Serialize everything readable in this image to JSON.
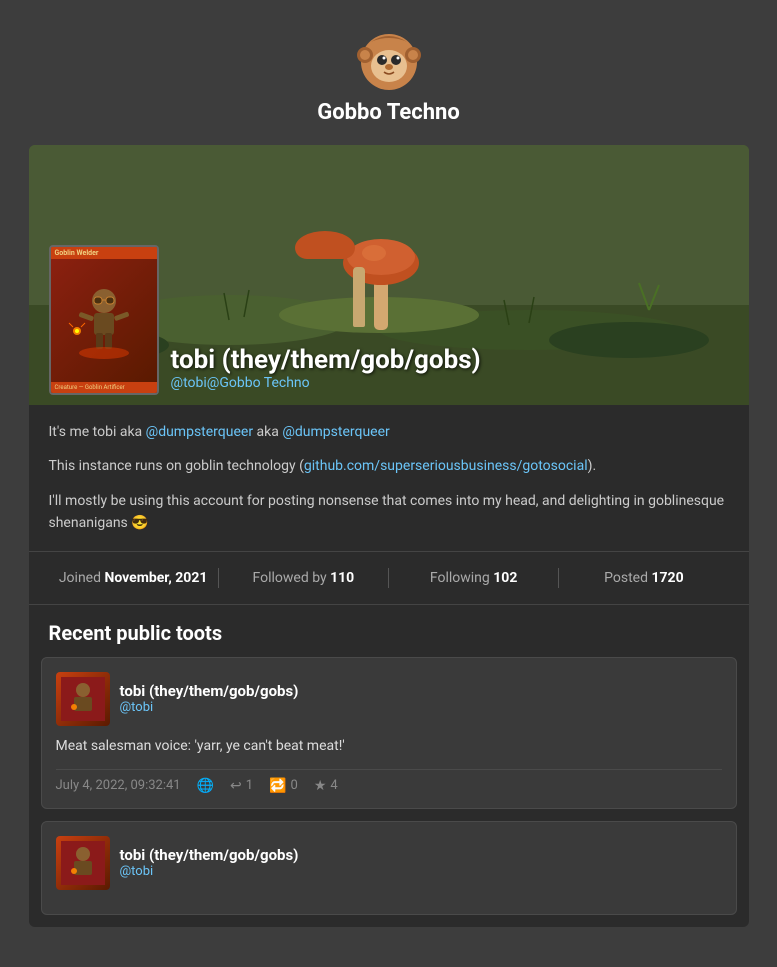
{
  "app": {
    "title": "Gobbo Techno"
  },
  "profile": {
    "display_name": "tobi (they/them/gob/gobs)",
    "handle": "@tobi@Gobbo Techno",
    "bio_lines": [
      "It's me tobi aka @dumpsterqueer aka @dumpsterqueer",
      "This instance runs on goblin technology (github.com/superseriousbusiness/gotosocial).",
      "I'll mostly be using this account for posting nonsense that comes into my head, and delighting in goblinesque shenanigans 😎"
    ],
    "joined_label": "Joined",
    "joined_date": "November, 2021",
    "followed_by_label": "Followed by",
    "followed_by_count": "110",
    "following_label": "Following",
    "following_count": "102",
    "posted_label": "Posted",
    "posted_count": "1720"
  },
  "recent_toots": {
    "section_title": "Recent public toots",
    "items": [
      {
        "author_name": "tobi (they/them/gob/gobs)",
        "author_handle": "@tobi",
        "content": "Meat salesman voice: 'yarr, ye can't beat meat!'",
        "timestamp": "July 4, 2022, 09:32:41",
        "replies": "1",
        "boosts": "0",
        "favorites": "4"
      },
      {
        "author_name": "tobi (they/them/gob/gobs)",
        "author_handle": "@tobi",
        "content": "",
        "timestamp": "",
        "replies": "",
        "boosts": "",
        "favorites": ""
      }
    ]
  },
  "icons": {
    "globe": "🌐",
    "reply": "↩",
    "boost": "🔁",
    "favorite": "★"
  }
}
